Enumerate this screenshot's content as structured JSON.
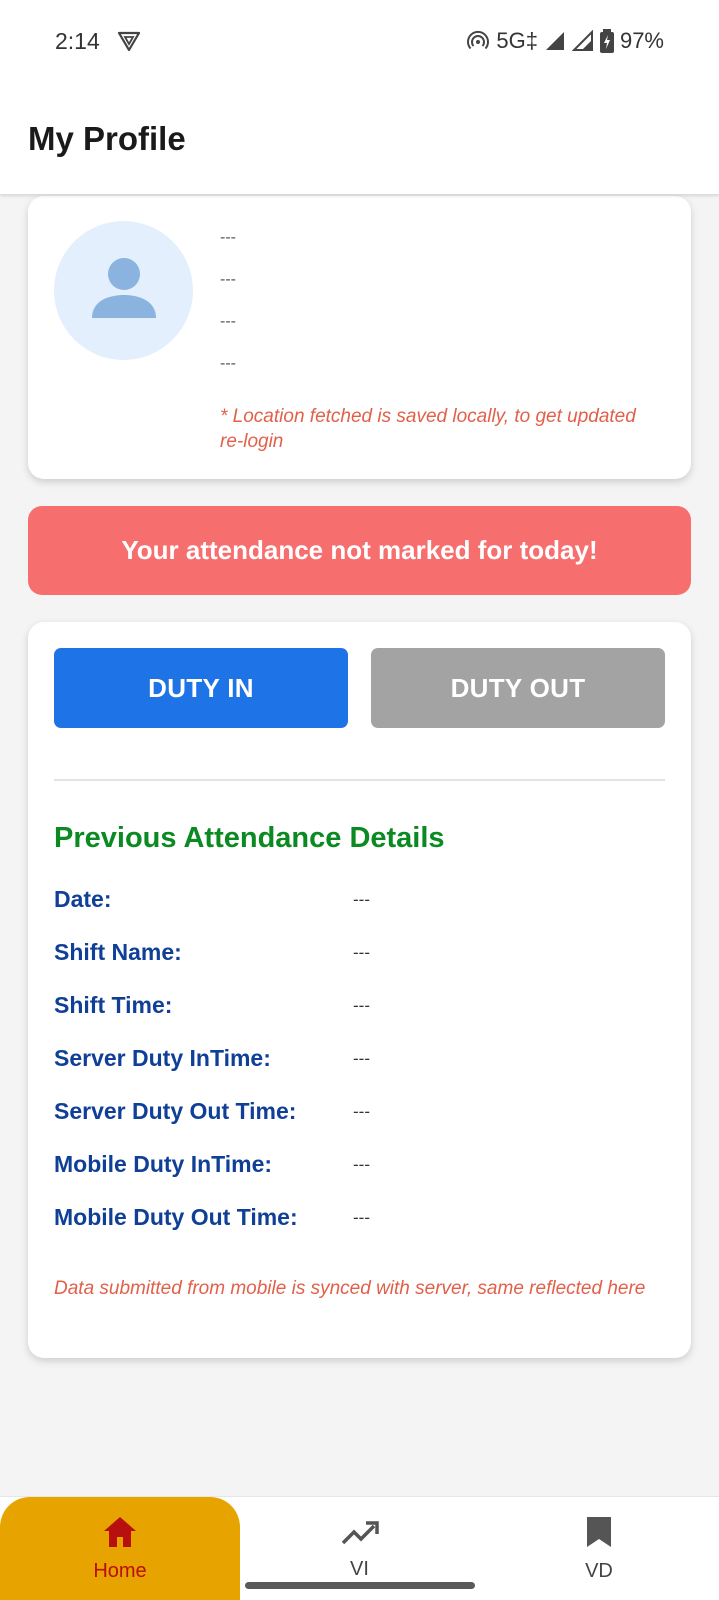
{
  "status_bar": {
    "time": "2:14",
    "network": "5G‡",
    "battery": "97%"
  },
  "header": {
    "title": "My Profile"
  },
  "profile": {
    "lines": [
      "---",
      "---",
      "---",
      "---"
    ],
    "location_note": "* Location fetched is saved locally, to get updated re-login",
    "avatar_icon": "person-icon"
  },
  "alert": {
    "text": "Your attendance not marked for today!",
    "color": "#f76e6e"
  },
  "duty": {
    "in_label": "DUTY IN",
    "out_label": "DUTY OUT",
    "in_color": "#1e73e6",
    "out_color": "#a3a3a3"
  },
  "previous_attendance": {
    "title": "Previous Attendance Details",
    "rows": [
      {
        "label": "Date:",
        "value": "---"
      },
      {
        "label": "Shift Name:",
        "value": "---"
      },
      {
        "label": "Shift Time:",
        "value": "---"
      },
      {
        "label": "Server Duty InTime:",
        "value": "---"
      },
      {
        "label": "Server Duty Out Time:",
        "value": "---"
      },
      {
        "label": "Mobile Duty InTime:",
        "value": "---"
      },
      {
        "label": "Mobile Duty Out Time:",
        "value": "---"
      }
    ],
    "sync_note": "Data submitted from mobile is synced with server, same reflected here"
  },
  "bottom_nav": {
    "items": [
      {
        "label": "Home",
        "icon": "home-icon",
        "active": true
      },
      {
        "label": "VI",
        "icon": "trending-up-icon",
        "active": false
      },
      {
        "label": "VD",
        "icon": "bookmark-icon",
        "active": false
      }
    ],
    "active_color": "#e7a300"
  }
}
